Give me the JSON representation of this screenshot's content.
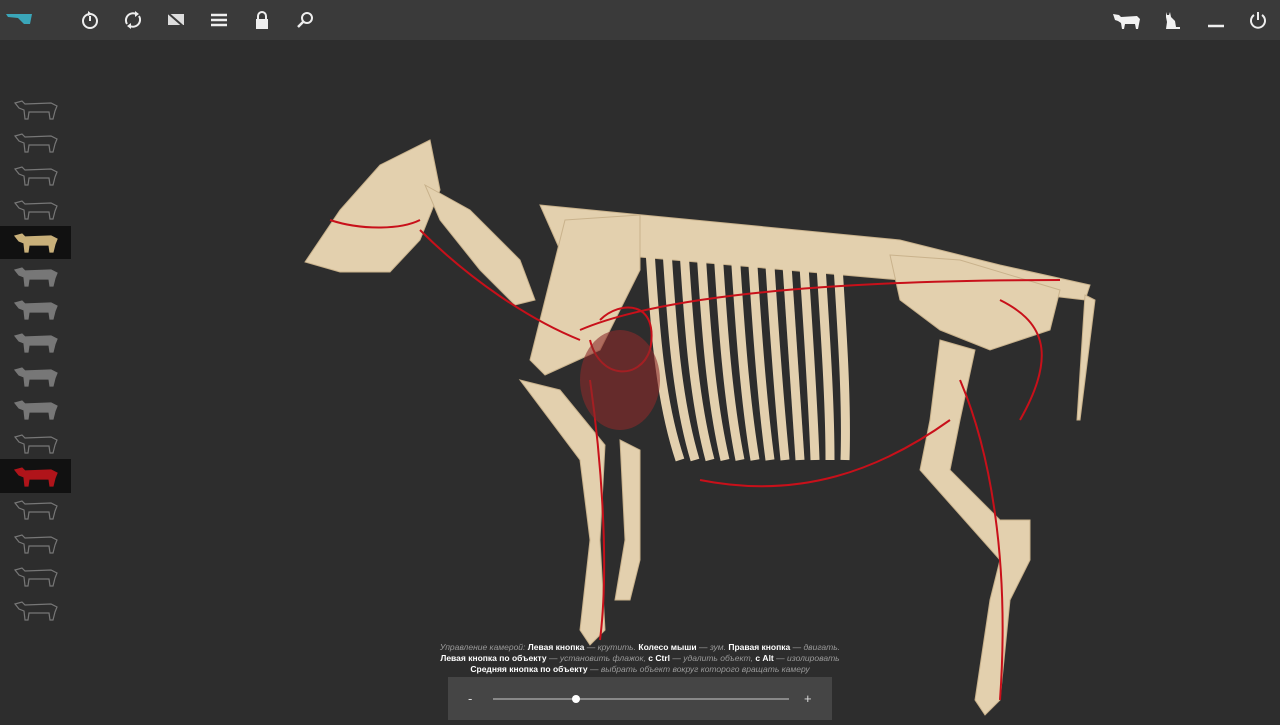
{
  "toolbar": {
    "left": [
      "app-logo",
      "reset-view-icon",
      "refresh-icon",
      "hide-labels-icon",
      "menu-icon",
      "lock-icon",
      "search-icon"
    ],
    "right": [
      "cow-icon",
      "cat-icon",
      "minimize-icon",
      "power-icon"
    ]
  },
  "sidebar": {
    "items": [
      "skin",
      "muscles-superficial",
      "muscles-deep",
      "skeleton-dark",
      "skeleton",
      "organ-1",
      "organ-2",
      "organ-3",
      "organ-4",
      "organ-5",
      "muscles-striped",
      "circulatory",
      "nervous",
      "lymphatic",
      "body-1",
      "body-2"
    ],
    "active": [
      4,
      11
    ]
  },
  "help": {
    "l1a": "Управление камерой:",
    "l1b": "Левая кнопка",
    "l1c": "— крутить.",
    "l1d": "Колесо мыши",
    "l1e": "— зум.",
    "l1f": "Правая кнопка",
    "l1g": "— двигать.",
    "l2a": "Левая кнопка по объекту",
    "l2b": "— установить флажок,",
    "l2c": "с Ctrl",
    "l2d": "— удалить объект,",
    "l2e": "с Alt",
    "l2f": "— изолировать",
    "l3a": "Средняя кнопка по объекту",
    "l3b": "— выбрать объект вокруг которого вращать камеру"
  },
  "zoom": {
    "minus": "-",
    "plus": "+",
    "value": 0.28
  },
  "colors": {
    "bone": "#e6d3b3",
    "artery": "#d0141a",
    "bg": "#2d2d2d",
    "toolbar": "#3a3a3a"
  }
}
